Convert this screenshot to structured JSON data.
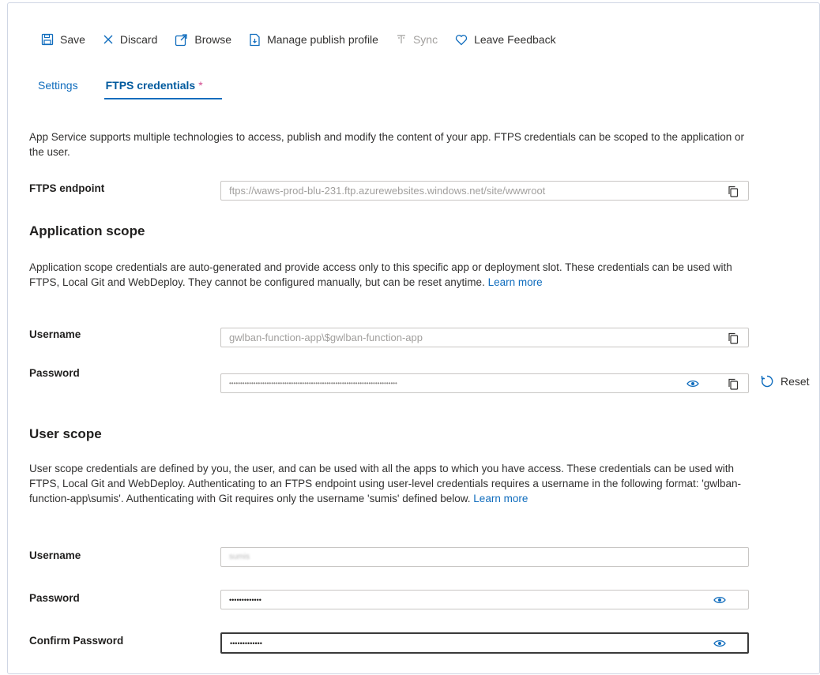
{
  "toolbar": {
    "save": "Save",
    "discard": "Discard",
    "browse": "Browse",
    "manage_publish_profile": "Manage publish profile",
    "sync": "Sync",
    "leave_feedback": "Leave Feedback"
  },
  "tabs": {
    "settings": "Settings",
    "ftps_credentials": "FTPS credentials",
    "modified_marker": "*"
  },
  "intro": "App Service supports multiple technologies to access, publish and modify the content of your app. FTPS credentials can be scoped to the application or the user.",
  "ftps_endpoint": {
    "label": "FTPS endpoint",
    "value": "ftps://waws-prod-blu-231.ftp.azurewebsites.windows.net/site/wwwroot"
  },
  "application_scope": {
    "heading": "Application scope",
    "description": "Application scope credentials are auto-generated and provide access only to this specific app or deployment slot. These credentials can be used with FTPS, Local Git and WebDeploy. They cannot be configured manually, but can be reset anytime.",
    "learn_more": "Learn more",
    "username_label": "Username",
    "username_value": "gwlban-function-app\\$gwlban-function-app",
    "password_label": "Password",
    "password_value": "••••••••••••••••••••••••••••••••••••••••••••••••••••••••••••••••••••••••••••",
    "reset": "Reset"
  },
  "user_scope": {
    "heading": "User scope",
    "description": "User scope credentials are defined by you, the user, and can be used with all the apps to which you have access. These credentials can be used with FTPS, Local Git and WebDeploy. Authenticating to an FTPS endpoint using user-level credentials requires a username in the following format: 'gwlban-function-app\\sumis'. Authenticating with Git requires only the username 'sumis' defined below.",
    "learn_more": "Learn more",
    "username_label": "Username",
    "username_value": "sumis",
    "password_label": "Password",
    "password_value": "•••••••••••••",
    "confirm_label": "Confirm Password",
    "confirm_value": "•••••••••••••"
  },
  "colors": {
    "link": "#0f6cbd",
    "tab_underline": "#0f6cbd",
    "modified_star": "#d24b8f",
    "icon_blue": "#0f6cbd"
  },
  "icons": [
    "save-icon",
    "discard-icon",
    "browse-icon",
    "publish-profile-icon",
    "sync-icon",
    "feedback-icon",
    "copy-icon",
    "eye-icon",
    "reset-icon"
  ]
}
